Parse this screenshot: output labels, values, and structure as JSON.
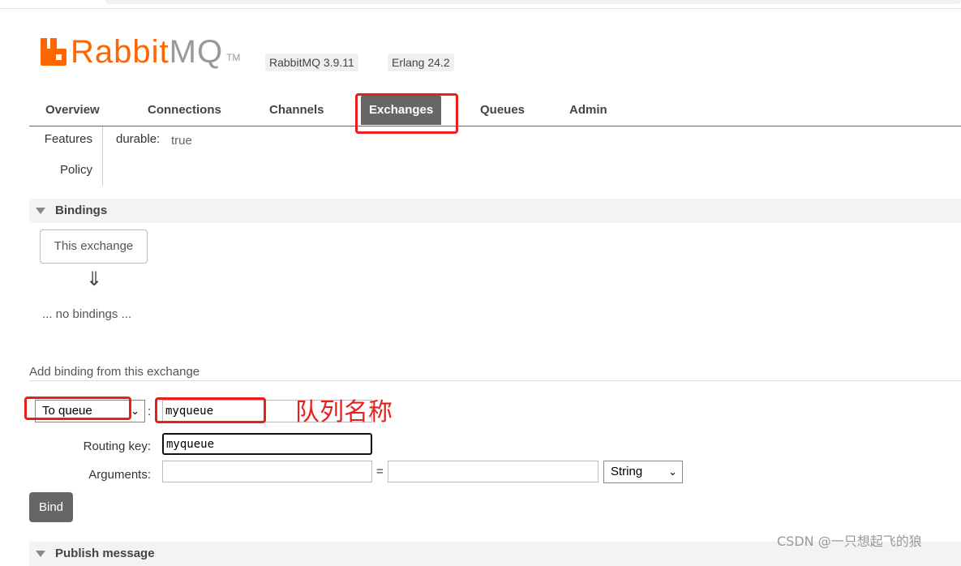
{
  "header": {
    "logo_rabbit": "Rabbit",
    "logo_mq": "MQ",
    "logo_tm": "TM",
    "version_badge": "RabbitMQ 3.9.11",
    "erlang_badge": "Erlang 24.2",
    "brand_color": "#ff6600"
  },
  "nav": {
    "tabs": [
      {
        "label": "Overview"
      },
      {
        "label": "Connections"
      },
      {
        "label": "Channels"
      },
      {
        "label": "Exchanges",
        "active": true
      },
      {
        "label": "Queues"
      },
      {
        "label": "Admin"
      }
    ]
  },
  "details": {
    "features_label": "Features",
    "policy_label": "Policy",
    "durable_key": "durable:",
    "durable_value": "true"
  },
  "bindings": {
    "title": "Bindings",
    "this_exchange": "This exchange",
    "arrow": "⇓",
    "no_bindings": "... no bindings ..."
  },
  "add_binding": {
    "title": "Add binding from this exchange",
    "destination_type": "To queue",
    "destination_colon": ":",
    "destination_value": "myqueue",
    "routing_key_label": "Routing key:",
    "routing_key_value": "myqueue",
    "arguments_label": "Arguments:",
    "equals": "=",
    "argument_type": "String",
    "bind_button": "Bind"
  },
  "annotation": {
    "text": "队列名称",
    "color": "#e8201c"
  },
  "next_section": {
    "title": "Publish message"
  },
  "watermark": "CSDN @一只想起飞的狼"
}
